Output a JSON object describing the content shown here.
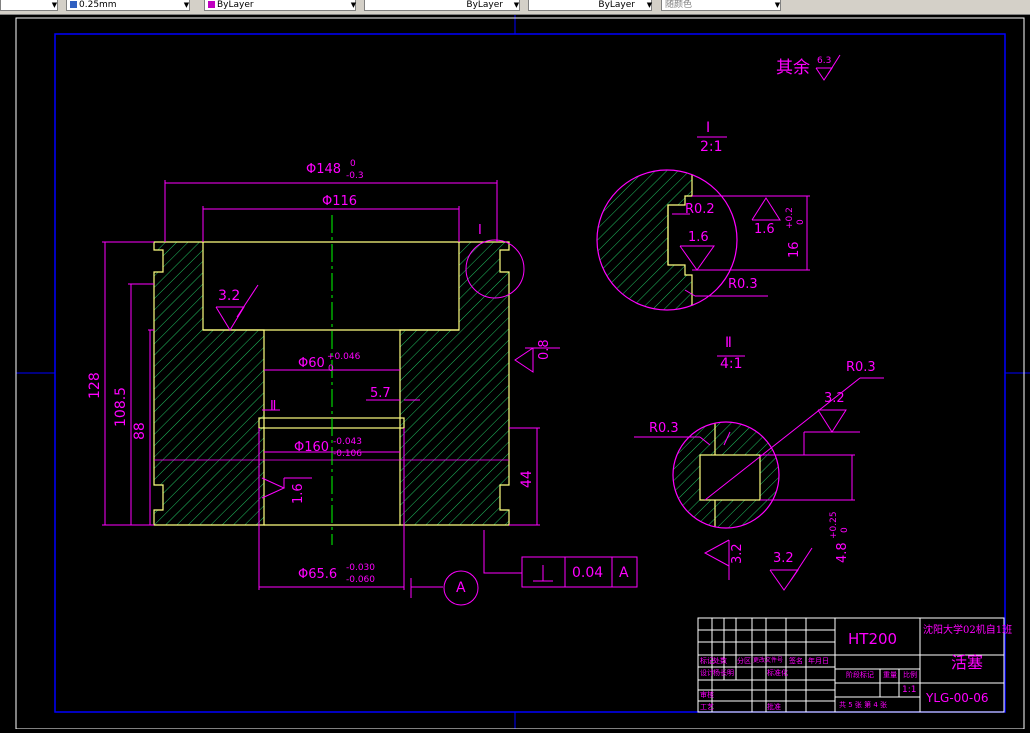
{
  "toolbar": {
    "items": [
      {
        "label": "",
        "has_arrow": true
      },
      {
        "label": "0.25mm",
        "has_arrow": true
      },
      {
        "label": "ByLayer",
        "has_arrow": true
      },
      {
        "label": "ByLayer",
        "has_arrow": true
      },
      {
        "label": "ByLayer",
        "has_arrow": true
      },
      {
        "label": "随颜色",
        "has_arrow": true
      }
    ]
  },
  "drawing": {
    "surface_note": "其余",
    "surface_note_value": "6.3",
    "section_I_label": "I",
    "section_I_scale": "2:1",
    "section_II_label": "Ⅱ",
    "section_II_scale": "4:1",
    "main": {
      "phi148": "Φ148",
      "phi148_tol_upper": "0",
      "phi148_tol_lower": "-0.3",
      "phi116": "Φ116",
      "marker_I": "I",
      "marker_II": "Ⅱ",
      "rough_32": "3.2",
      "rough_08": "0.8",
      "rough_16": "1.6",
      "phi60": "Φ60",
      "phi60_tol_upper": "+0.046",
      "phi60_tol_lower": "0",
      "dim_57": "5.7",
      "phi160": "Φ160",
      "phi160_tol_upper": "-0.043",
      "phi160_tol_lower": "-0.106",
      "phi656": "Φ65.6",
      "phi656_tol_upper": "-0.030",
      "phi656_tol_lower": "-0.060",
      "dim_128": "128",
      "dim_1085": "108.5",
      "dim_88": "88",
      "dim_44": "44",
      "datum": "A",
      "tol_value": "0.04",
      "tol_datum": "A"
    },
    "detail_I": {
      "r02": "R0.2",
      "r03": "R0.3",
      "rough_16a": "1.6",
      "rough_16b": "1.6",
      "dim_16": "16",
      "dim_16_tol_upper": "+0.2",
      "dim_16_tol_lower": "0"
    },
    "detail_II": {
      "r03_left": "R0.3",
      "r03_right": "R0.3",
      "rough_32a": "3.2",
      "rough_32b": "3.2",
      "rough_32c": "3.2",
      "dim_48": "4.8",
      "dim_48_tol_upper": "+0.25",
      "dim_48_tol_lower": "0"
    },
    "title_block": {
      "material": "HT200",
      "school": "沈阳大学02机自1班",
      "part_name": "活塞",
      "drawing_no": "YLG-00-06",
      "scale": "1:1",
      "sheet_info": "共 5 张  第 4 张",
      "row_labels": [
        "标记",
        "处数",
        "分区",
        "更改文件号",
        "签名",
        "年月日"
      ],
      "design_label": "设计",
      "designer": "杨长明",
      "std_label": "标准化",
      "review_label": "审核",
      "process_label": "工艺",
      "approve_label": "批准",
      "stage_label": "阶段标记",
      "weight_label": "重量",
      "ratio_label": "比例"
    }
  },
  "colors": {
    "frame": "#0000ff",
    "dimension": "#ff00ff",
    "outline": "#ffff80",
    "hatch": "#20c060",
    "centerline": "#00ff00",
    "text": "#ff00ff"
  }
}
